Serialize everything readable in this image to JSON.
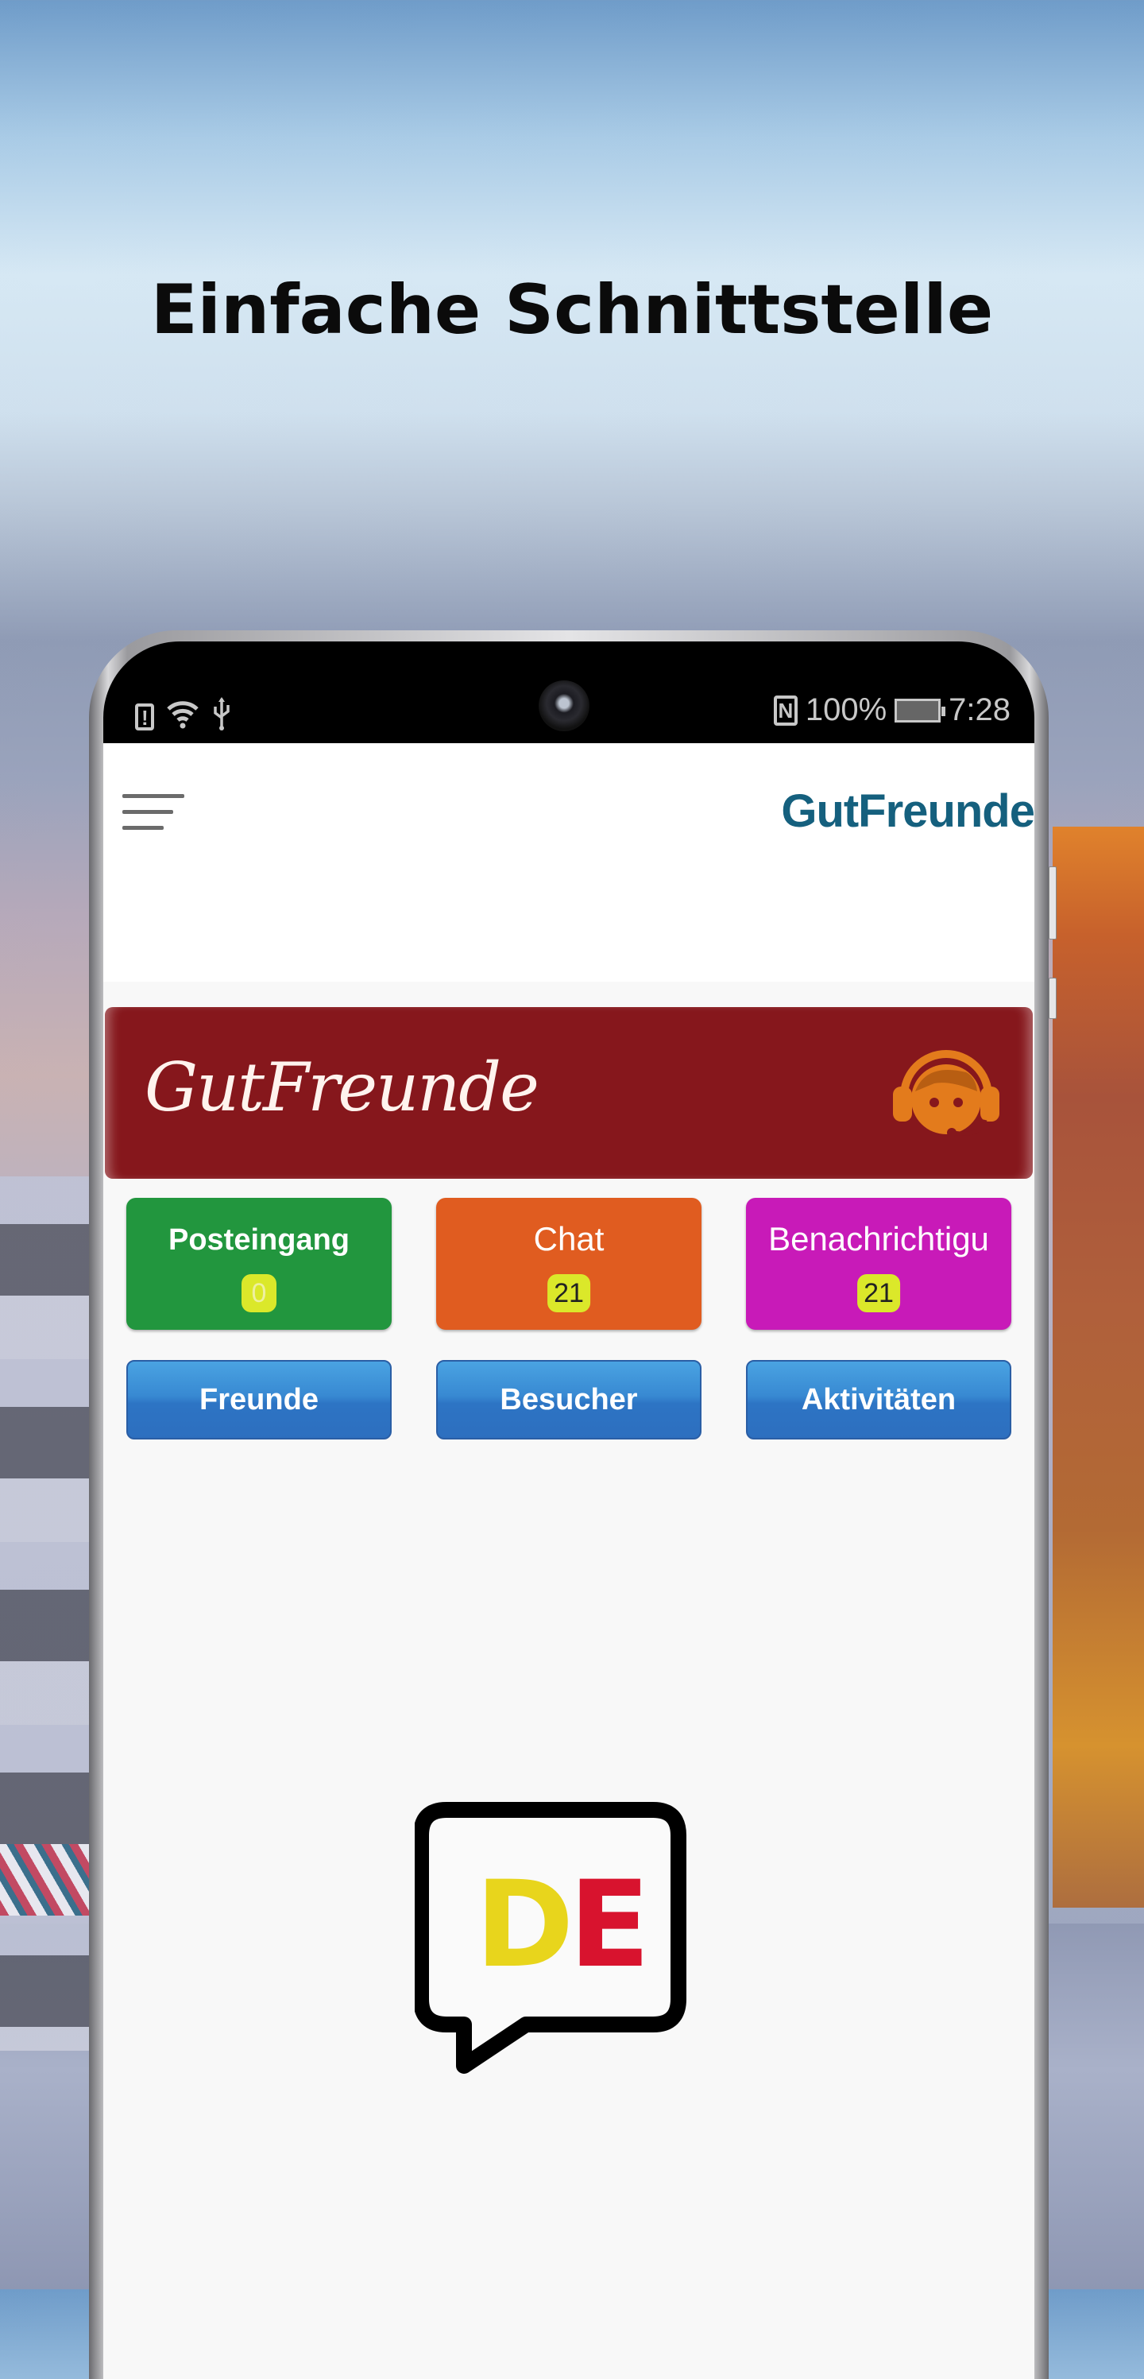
{
  "promo": {
    "title": "Einfache Schnittstelle"
  },
  "statusbar": {
    "left_icons": [
      "sim-alert-icon",
      "wifi-icon",
      "usb-icon"
    ],
    "nfc_label": "N",
    "battery_percent": "100%",
    "battery_icon": "battery-charging-icon",
    "time": "7:28"
  },
  "header": {
    "menu_icon": "hamburger-menu-icon",
    "logo_text": "GutFreunde"
  },
  "banner": {
    "logo_text": "GutFreunde",
    "icon": "support-headset-icon"
  },
  "tiles": [
    {
      "label": "Posteingang",
      "badge": "0",
      "color": "#22963e"
    },
    {
      "label": "Chat",
      "badge": "21",
      "color": "#e05c20"
    },
    {
      "label": "Benachrichtigu",
      "badge": "21",
      "color": "#c81ab8"
    }
  ],
  "buttons": [
    {
      "label": "Freunde"
    },
    {
      "label": "Besucher"
    },
    {
      "label": "Aktivitäten"
    }
  ],
  "language_logo": {
    "letter1": "D",
    "letter1_color": "#e8d51c",
    "letter2": "E",
    "letter2_color": "#d8132e"
  },
  "colors": {
    "banner": "#86171c",
    "header_logo": "#15607e",
    "badge": "#dbe82a",
    "button_blue": "#3889d2",
    "support_icon": "#e37b1c"
  }
}
